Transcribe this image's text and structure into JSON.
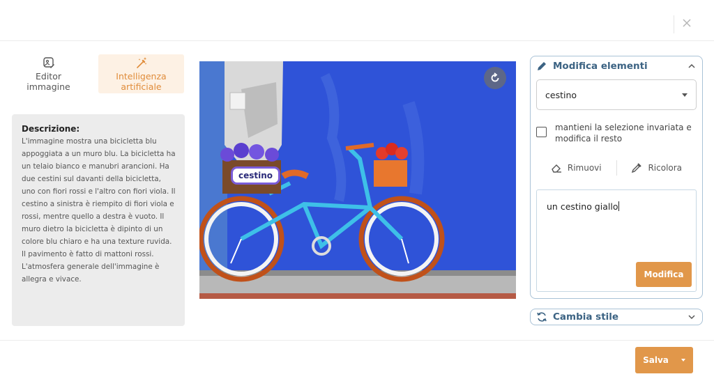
{
  "header": {
    "close_icon": "close-icon"
  },
  "tabs": [
    {
      "label_line1": "Editor",
      "label_line2": "immagine",
      "icon": "image-edit-icon"
    },
    {
      "label_line1": "Intelligenza",
      "label_line2": "artificiale",
      "icon": "magic-wand-icon",
      "active": true
    }
  ],
  "description": {
    "title": "Descrizione:",
    "text": "L'immagine mostra una bicicletta blu appoggiata a un muro blu. La bicicletta ha un telaio bianco e manubri arancioni. Ha due cestini sul davanti della bicicletta, uno con fiori rossi e l'altro con fiori viola. Il cestino a sinistra è riempito di fiori viola e rossi, mentre quello a destra è vuoto. Il muro dietro la bicicletta è dipinto di un colore blu chiaro e ha una texture ruvida. Il pavimento è fatto di mattoni rossi. L'atmosfera generale dell'immagine è allegra e vivace."
  },
  "image": {
    "selection_label": "cestino",
    "reset_icon": "refresh-icon"
  },
  "edit_panel": {
    "title": "Modifica elementi",
    "selected_element": "cestino",
    "keep_selection_label": "mantieni la selezione invariata e modifica il resto",
    "remove_label": "Rimuovi",
    "recolor_label": "Ricolora",
    "prompt_value": "un cestino giallo",
    "submit_label": "Modifica"
  },
  "style_panel": {
    "title": "Cambia stile"
  },
  "footer": {
    "save_label": "Salva"
  },
  "colors": {
    "accent": "#e1974a",
    "panel_title": "#3c6383",
    "panel_border": "#a9c2d6"
  }
}
